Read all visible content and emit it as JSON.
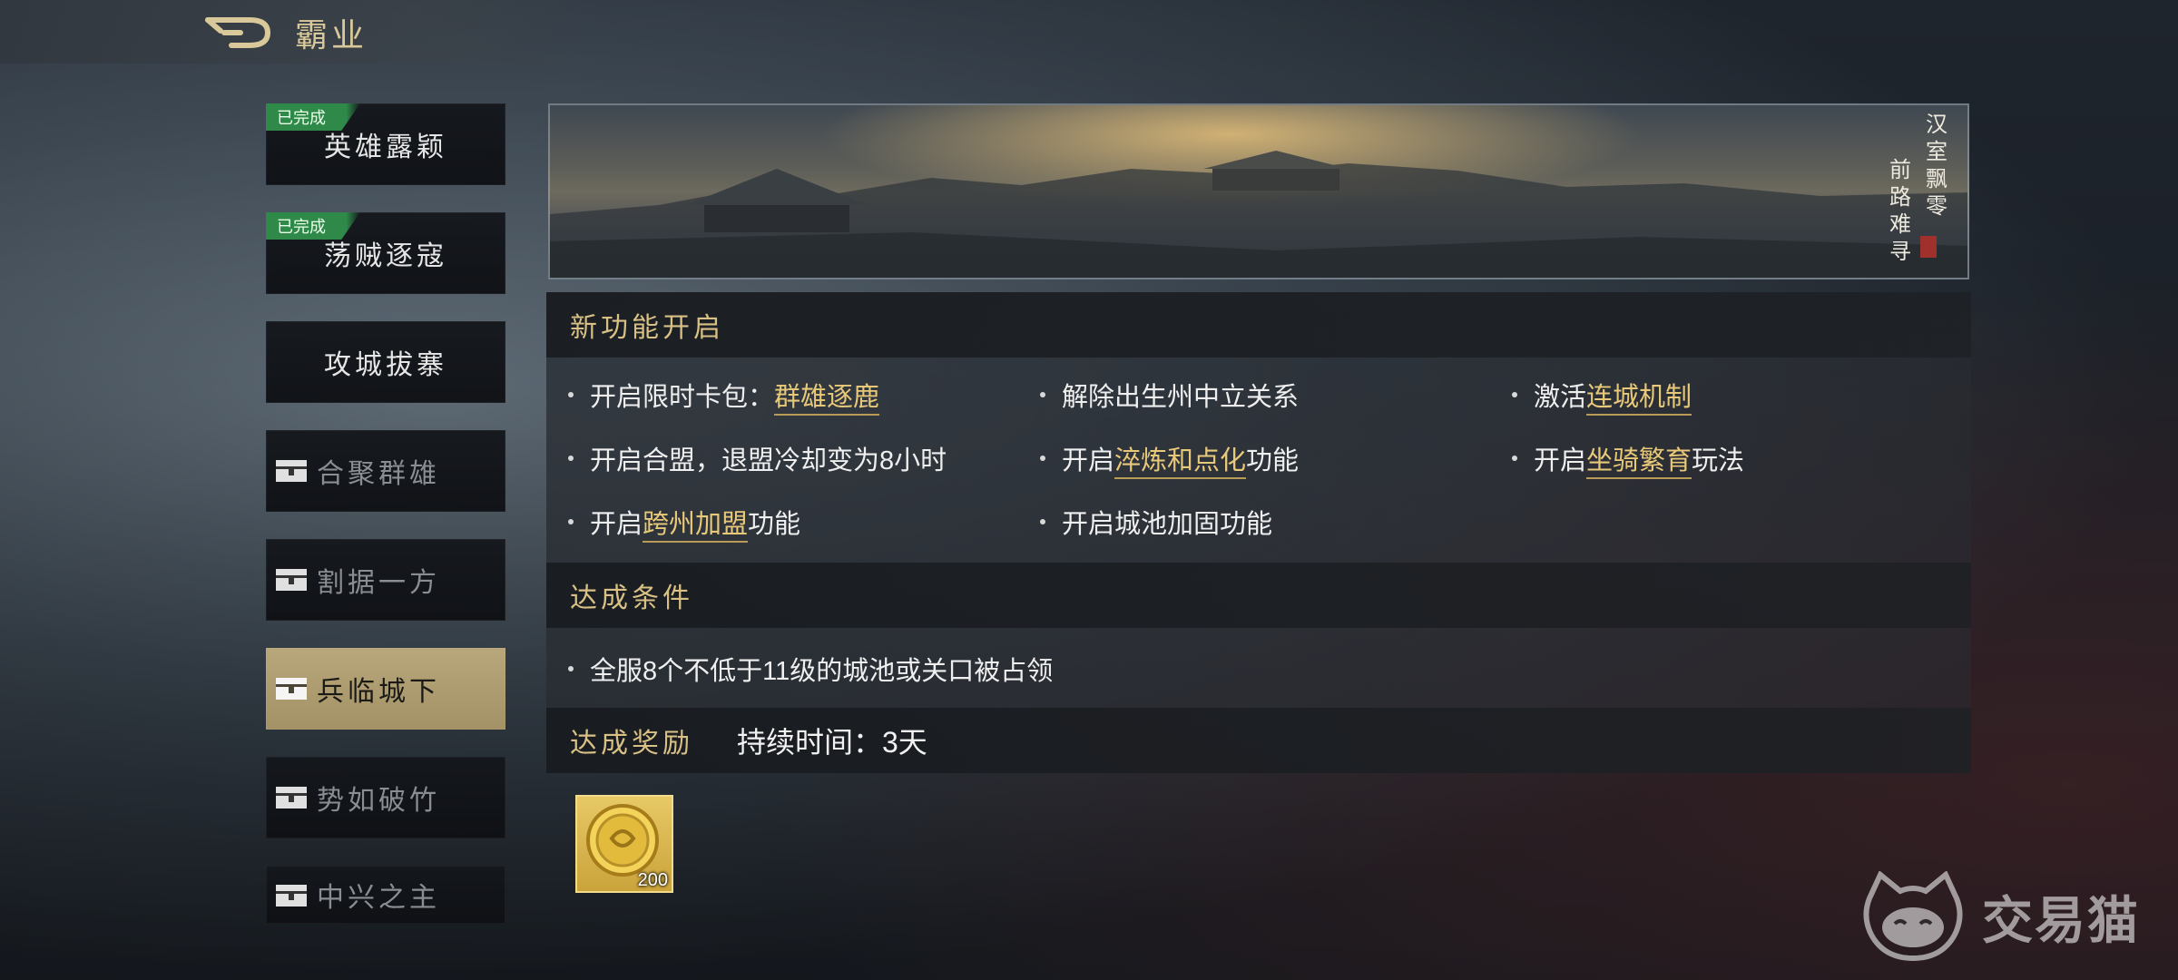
{
  "header": {
    "title": "霸业"
  },
  "tabs": [
    {
      "label": "英雄露颖",
      "badge": "已完成",
      "state": "completed"
    },
    {
      "label": "荡贼逐寇",
      "badge": "已完成",
      "state": "completed"
    },
    {
      "label": "攻城拔寨",
      "badge": "",
      "state": "open"
    },
    {
      "label": "合聚群雄",
      "badge": "",
      "state": "locked"
    },
    {
      "label": "割据一方",
      "badge": "",
      "state": "locked"
    },
    {
      "label": "兵临城下",
      "badge": "",
      "state": "locked-selected"
    },
    {
      "label": "势如破竹",
      "badge": "",
      "state": "locked"
    },
    {
      "label": "中兴之主",
      "badge": "",
      "state": "locked"
    }
  ],
  "banner": {
    "col1": "汉室飘零",
    "col2": "前路难寻"
  },
  "features": {
    "header": "新功能开启",
    "items": [
      {
        "prefix": "开启限时卡包：",
        "link": "群雄逐鹿",
        "suffix": ""
      },
      {
        "prefix": "解除出生州中立关系",
        "link": "",
        "suffix": ""
      },
      {
        "prefix": "激活",
        "link": "连城机制",
        "suffix": ""
      },
      {
        "prefix": "开启合盟，退盟冷却变为8小时",
        "link": "",
        "suffix": ""
      },
      {
        "prefix": "开启",
        "link": "淬炼和点化",
        "suffix": "功能"
      },
      {
        "prefix": "开启",
        "link": "坐骑繁育",
        "suffix": "玩法"
      },
      {
        "prefix": "开启",
        "link": "跨州加盟",
        "suffix": "功能"
      },
      {
        "prefix": "开启城池加固功能",
        "link": "",
        "suffix": ""
      }
    ]
  },
  "conditions": {
    "header": "达成条件",
    "items": [
      "全服8个不低于11级的城池或关口被占领"
    ]
  },
  "rewards": {
    "header": "达成奖励",
    "duration": "持续时间：3天",
    "items": [
      {
        "icon": "gold-coin-icon",
        "count": "200"
      }
    ]
  },
  "watermark": {
    "text": "交易猫"
  },
  "colors": {
    "accent_gold": "#d9c186",
    "link_gold": "#e8c97a",
    "completed_green": "#2f8a4a",
    "active_tab": "#b8a77a"
  }
}
